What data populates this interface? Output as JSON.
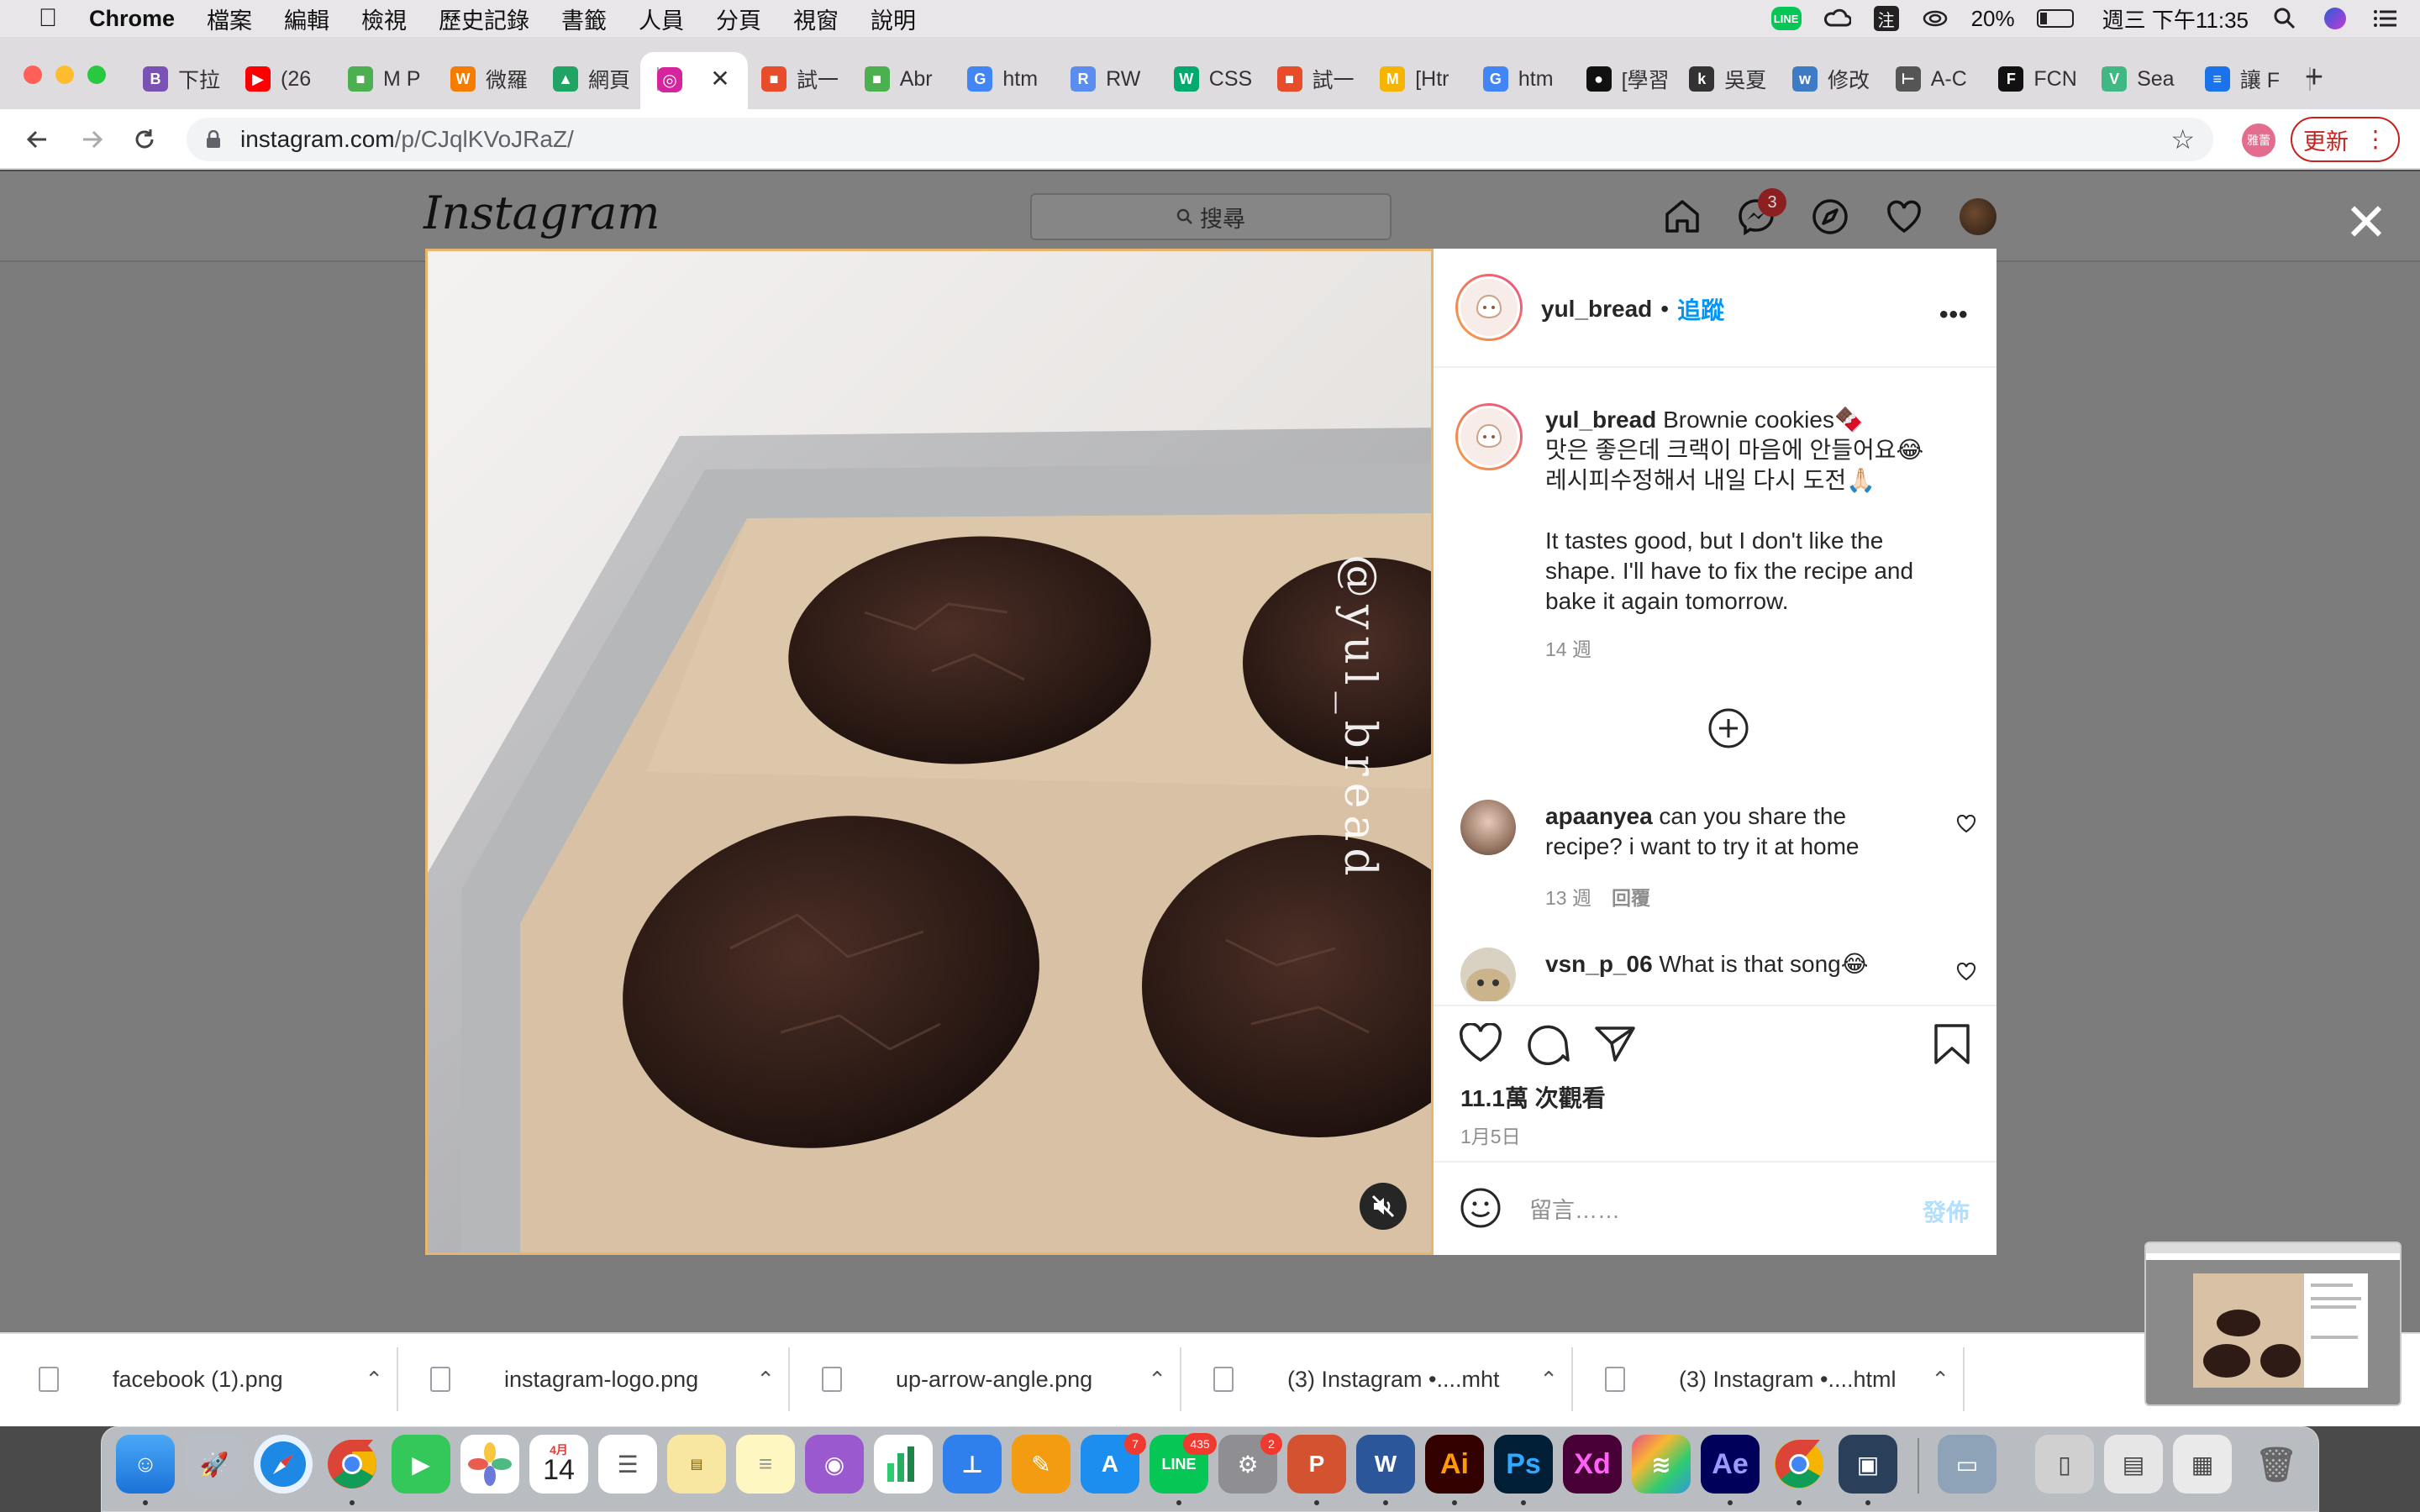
{
  "menubar": {
    "app_name": "Chrome",
    "items": [
      "檔案",
      "編輯",
      "檢視",
      "歷史記錄",
      "書籤",
      "人員",
      "分頁",
      "視窗",
      "說明"
    ],
    "battery": "20%",
    "clock": "週三 下午11:35",
    "input_method": "注"
  },
  "tabs": [
    {
      "label": "下拉",
      "icon": "bootstrap-icon",
      "color": "#7952b3",
      "glyph": "B"
    },
    {
      "label": "(26",
      "icon": "youtube-icon",
      "color": "#ff0000",
      "glyph": "▶"
    },
    {
      "label": "M P",
      "icon": "grid-icon",
      "color": "#4caf50",
      "glyph": "■"
    },
    {
      "label": "微羅",
      "icon": "weibo-icon",
      "color": "#f57c00",
      "glyph": "W"
    },
    {
      "label": "網頁",
      "icon": "google-drive-icon",
      "color": "#1fa463",
      "glyph": "▲"
    },
    {
      "label": "",
      "icon": "instagram-icon",
      "color": "#d6249f",
      "glyph": "◎"
    },
    {
      "label": "試一",
      "icon": "office-icon",
      "color": "#e94c2a",
      "glyph": "■"
    },
    {
      "label": "Abr",
      "icon": "grid-icon",
      "color": "#4caf50",
      "glyph": "■"
    },
    {
      "label": "htm",
      "icon": "google-icon",
      "color": "#4285f4",
      "glyph": "G"
    },
    {
      "label": "RW",
      "icon": "rwd-icon",
      "color": "#5a8dee",
      "glyph": "R"
    },
    {
      "label": "CSS",
      "icon": "w3schools-icon",
      "color": "#04aa6d",
      "glyph": "W"
    },
    {
      "label": "試一",
      "icon": "office-icon",
      "color": "#e94c2a",
      "glyph": "■"
    },
    {
      "label": "[Htr",
      "icon": "medium-icon",
      "color": "#f4b400",
      "glyph": "M"
    },
    {
      "label": "htm",
      "icon": "google-icon",
      "color": "#4285f4",
      "glyph": "G"
    },
    {
      "label": "[學習",
      "icon": "medium-icon",
      "color": "#111111",
      "glyph": "●"
    },
    {
      "label": "吳夏",
      "icon": "k-icon",
      "color": "#333333",
      "glyph": "k"
    },
    {
      "label": "修改",
      "icon": "w-icon",
      "color": "#3e7bc4",
      "glyph": "w"
    },
    {
      "label": "A-C",
      "icon": "ruler-icon",
      "color": "#555555",
      "glyph": "⊢"
    },
    {
      "label": "FCN",
      "icon": "fcn-icon",
      "color": "#111111",
      "glyph": "F"
    },
    {
      "label": "Sea",
      "icon": "vue-icon",
      "color": "#41b883",
      "glyph": "V"
    },
    {
      "label": "讓 F",
      "icon": "doc-icon",
      "color": "#1a73e8",
      "glyph": "≡"
    }
  ],
  "toolbar": {
    "url_host": "instagram.com",
    "url_path": "/p/CJqlKVoJRaZ/",
    "profile_label": "雅蕾",
    "update_label": "更新"
  },
  "instagram": {
    "logo_text": "Instagram",
    "search_placeholder": "搜尋",
    "messages_badge": "3"
  },
  "post": {
    "watermark": "@yul_bread",
    "author": "yul_bread",
    "follow_label": "追蹤",
    "follow_sep": "•",
    "caption_title": "Brownie cookies🍫",
    "caption_lines": [
      "맛은 좋은데 크랙이 마음에 안들어요😂",
      "레시피수정해서 내일 다시 도전🙏🏻",
      "",
      "It tastes good, but I don't like the",
      "shape. I'll have to fix the recipe and",
      "bake it again tomorrow."
    ],
    "caption_age": "14 週",
    "comments": [
      {
        "user": "apaanyea",
        "text_line1": "can you share the",
        "text_line2": "recipe? i want to try it at home",
        "age": "13 週",
        "reply": "回覆"
      },
      {
        "user": "vsn_p_06",
        "text_line1": "What is that song😂"
      }
    ],
    "views": "11.1萬 次觀看",
    "date": "1月5日",
    "comment_placeholder": "留言……",
    "publish_label": "發佈"
  },
  "downloads": [
    {
      "name": "facebook (1).png"
    },
    {
      "name": "instagram-logo.png"
    },
    {
      "name": "up-arrow-angle.png"
    },
    {
      "name": "(3) Instagram •....mht"
    },
    {
      "name": "(3) Instagram •....html"
    }
  ],
  "dock": {
    "calendar_month": "4月",
    "calendar_day": "14",
    "appstore_badge": "7",
    "line_badge": "435",
    "settings_badge": "2",
    "ai_label": "Ai",
    "ps_label": "Ps",
    "xd_label": "Xd",
    "ae_label": "Ae"
  },
  "colors": {
    "instagram_blue": "#0095f6",
    "update_red": "#c5221f",
    "ig_gradient_start": "#f9a03f",
    "ig_gradient_end": "#e94f84"
  }
}
